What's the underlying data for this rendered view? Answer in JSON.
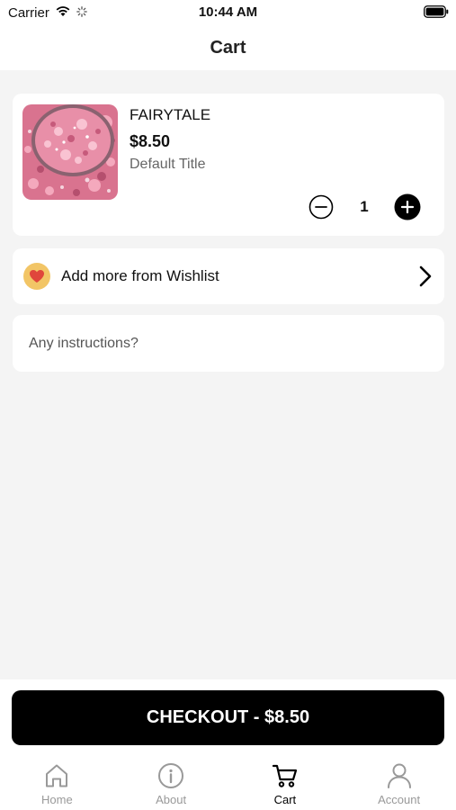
{
  "status_bar": {
    "carrier": "Carrier",
    "time": "10:44 AM"
  },
  "header": {
    "title": "Cart"
  },
  "cart_item": {
    "name": "FAIRYTALE",
    "price": "$8.50",
    "variant": "Default Title",
    "quantity": "1",
    "image_icon": "glitter-jar-image"
  },
  "wishlist": {
    "label": "Add more from Wishlist",
    "icon": "heart-icon"
  },
  "instructions": {
    "placeholder": "Any instructions?"
  },
  "checkout": {
    "label": "CHECKOUT - $8.50"
  },
  "tabs": [
    {
      "label": "Home",
      "icon": "home-icon",
      "active": false
    },
    {
      "label": "About",
      "icon": "info-icon",
      "active": false
    },
    {
      "label": "Cart",
      "icon": "cart-icon",
      "active": true
    },
    {
      "label": "Account",
      "icon": "account-icon",
      "active": false
    }
  ],
  "colors": {
    "accent": "#000000",
    "background": "#f4f4f4",
    "inactive_tab": "#999999",
    "heart_badge": "#f2c566",
    "heart": "#e0463c"
  }
}
